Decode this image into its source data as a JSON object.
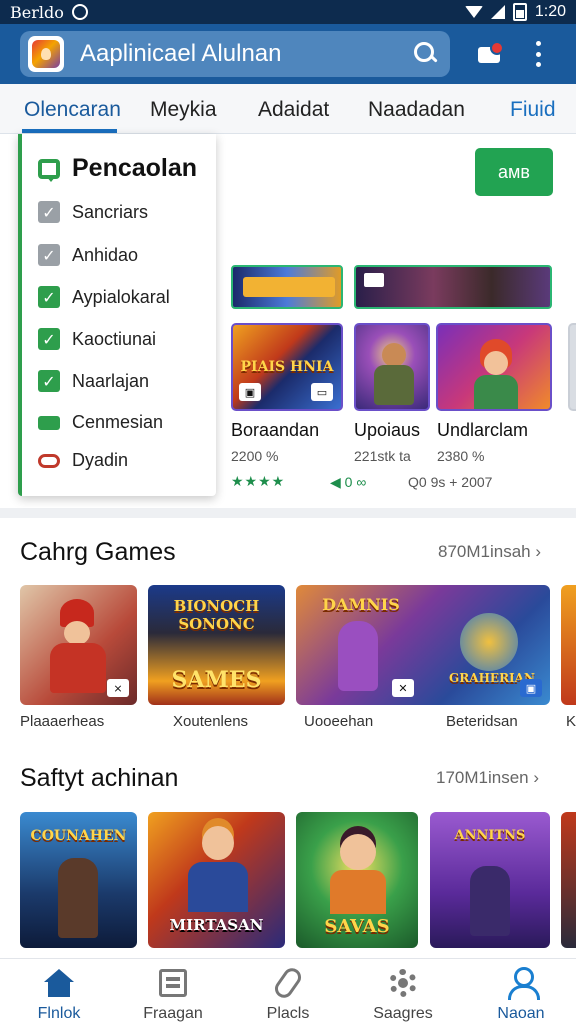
{
  "status_bar": {
    "carrier": "Berldo",
    "time": "1:20"
  },
  "app_bar": {
    "title": "Aaplinicael Alulnan"
  },
  "tabs": [
    {
      "label": "Olencaran",
      "active": true
    },
    {
      "label": "Meykia"
    },
    {
      "label": "Adaidat"
    },
    {
      "label": "Naadadan"
    },
    {
      "label": "Fiuid"
    }
  ],
  "filter_menu": {
    "title": "Pencaolan",
    "items": [
      {
        "label": "Sancriars",
        "state": "grey"
      },
      {
        "label": "Anhidao",
        "state": "grey"
      },
      {
        "label": "Aypialokaral",
        "state": "green"
      },
      {
        "label": "Kaoctiunai",
        "state": "green"
      },
      {
        "label": "Naarlajan",
        "state": "green"
      },
      {
        "label": "Cenmesian",
        "state": "partial"
      },
      {
        "label": "Dyadin",
        "state": "pill"
      }
    ]
  },
  "ok_button": {
    "label": "aмв"
  },
  "featured": {
    "tiles": [
      {
        "title": "Boraandan",
        "sub": "2200 %",
        "meta": "★★★★"
      },
      {
        "title": "Upoiaus",
        "sub": "221stk ta",
        "meta": "◀ 0 ∞"
      },
      {
        "title": "Undlarclam",
        "sub": "2380 %",
        "meta": "Q0 9s  +  2007"
      }
    ],
    "tile_art": [
      "PIAIS HNIA",
      ""
    ]
  },
  "section1": {
    "title": "Cahrg Games",
    "link": "870M1insah",
    "cards": [
      {
        "label": "Plaaaerheas",
        "art": ""
      },
      {
        "label": "Xoutenlens",
        "art": "SAMES"
      },
      {
        "label": "Uooeehan",
        "art": "DAMNIS"
      },
      {
        "label": "Beteridsan",
        "art": "GRAHERIAN"
      },
      {
        "label": "K"
      }
    ],
    "banner_art": "BIONOCH SONONC"
  },
  "section2": {
    "title": "Saftyt achinan",
    "link": "170M1insen",
    "cards": [
      {
        "art": "COUNAHEN"
      },
      {
        "art": "MIRTASAN"
      },
      {
        "art": "SAVAS"
      },
      {
        "art": "ANNITNS"
      }
    ]
  },
  "bottom_nav": [
    {
      "label": "Flnlok",
      "active": true
    },
    {
      "label": "Fraagan"
    },
    {
      "label": "Placls"
    },
    {
      "label": "Saagres"
    },
    {
      "label": "Naoan",
      "active": true
    }
  ]
}
